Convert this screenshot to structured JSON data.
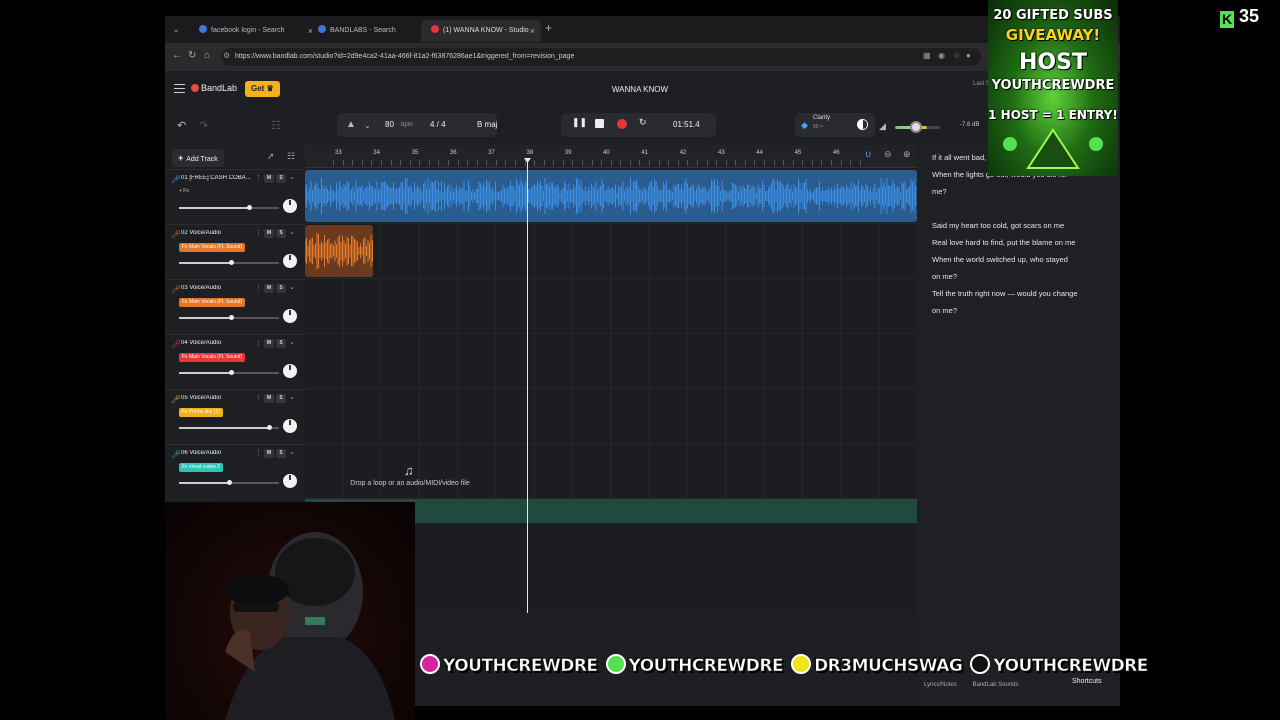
{
  "browser": {
    "tabs": [
      {
        "label": "facebook login - Search",
        "color": "#3a78d8"
      },
      {
        "label": "BANDLABS - Search",
        "color": "#3a78d8"
      },
      {
        "label": "(1) WANNA KNOW - Studio",
        "color": "#e8353a"
      }
    ],
    "url": "https://www.bandlab.com/studio?id=2d9e4ca2-41aa-466f-81a2-f63876286ae1&triggered_from=revision_page"
  },
  "app": {
    "logo": "BandLab",
    "get_label": "Get ♛",
    "song_title": "WANNA KNOW",
    "last_saved": "Last S"
  },
  "toolbar": {
    "tempo": "80",
    "tempo_unit": "bpm",
    "time_signature": "4 / 4",
    "key": "B maj",
    "time": "01:51.4",
    "clarity_label": "Clarity",
    "clarity_value": "50 >",
    "volume_db": "-7.6 dB",
    "volume_level": 0.42
  },
  "tracklist": {
    "add_track": "Add Track",
    "tracks": [
      {
        "name": "01 [FREE] CASH COBA...",
        "fx": "+ Fx",
        "fx_color": "",
        "icon_color": "#4aa3ff",
        "volume": 0.7
      },
      {
        "name": "02 Voice/Audio",
        "fx": "Fx Main Vocals (FL Sound)",
        "fx_color": "#e2772a",
        "icon_color": "#e2772a",
        "volume": 0.52
      },
      {
        "name": "03 Voice/Audio",
        "fx": "Fx Main Vocals (FL Sound)",
        "fx_color": "#e2772a",
        "icon_color": "#e2772a",
        "volume": 0.52
      },
      {
        "name": "04 Voice/Audio",
        "fx": "Fx Main Vocals (FL Sound)",
        "fx_color": "#e8353a",
        "icon_color": "#e8353a",
        "volume": 0.52
      },
      {
        "name": "05 Voice/Audio",
        "fx": "Fx Phone libs (1)",
        "fx_color": "#f2b21b",
        "icon_color": "#f2b21b",
        "volume": 0.9
      },
      {
        "name": "06 Voice/Audio",
        "fx": "Fx cheat codes 2",
        "fx_color": "#2ec4b6",
        "icon_color": "#2ec4b6",
        "volume": 0.5
      }
    ]
  },
  "timeline": {
    "bars": [
      "33",
      "34",
      "35",
      "36",
      "37",
      "38",
      "39",
      "40",
      "41",
      "42",
      "43",
      "44",
      "45",
      "46"
    ],
    "drop_text": "Drop a loop or an audio/MIDI/video file",
    "colors": {
      "beat": "#3d8fe6",
      "vocal": "#e67a2a",
      "green_lane": "#1f4a3d"
    }
  },
  "lyrics": {
    "lines": [
      "If it all went bad, would you lie for me?",
      "When the lights go out, would you die for",
      "me?",
      "",
      "Said my heart too cold, got scars on me",
      "Real love hard to find, put the blame on me",
      "When the world switched up, who stayed",
      "on me?",
      "Tell the truth right now — would you change",
      "on me?"
    ],
    "tabs": [
      "Lyrics/Notes",
      "BandLab Sounds"
    ],
    "shortcuts": "Shortcuts"
  },
  "overlays": {
    "promo": [
      "20 GIFTED SUBS",
      "GIVEAWAY!",
      "HOST",
      "YOUTHCREWDRE",
      "1 HOST = 1 ENTRY!"
    ],
    "kick_count": "35",
    "socials": [
      {
        "handle": "YOUTHCREWDRE",
        "icon": "instagram-icon",
        "color": "#d6249f"
      },
      {
        "handle": "YOUTHCREWDRE",
        "icon": "kick-icon",
        "color": "#52e252"
      },
      {
        "handle": "DR3MUCHSWAG",
        "icon": "snapchat-icon",
        "color": "#f2e31b"
      },
      {
        "handle": "YOUTHCREWDRE",
        "icon": "tiktok-icon",
        "color": "#111111"
      }
    ]
  }
}
